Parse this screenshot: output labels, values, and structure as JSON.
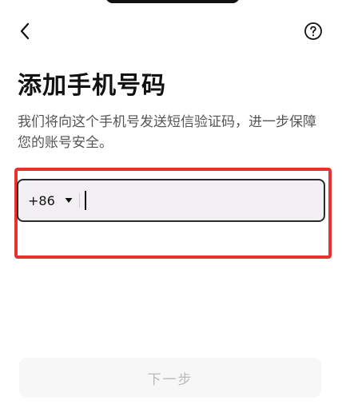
{
  "header": {
    "back_icon": "chevron-left-icon",
    "help_icon": "help-circle-icon"
  },
  "main": {
    "title": "添加手机号码",
    "description": "我们将向这个手机号发送短信验证码，进一步保障您的账号安全。",
    "phone": {
      "country_code": "+86",
      "dropdown_icon": "caret-down-icon",
      "value": "",
      "placeholder": ""
    },
    "next_button_label": "下一步"
  },
  "colors": {
    "highlight_border": "#e8322f",
    "input_background": "#f1eff1",
    "disabled_button_text": "#b9b9b9",
    "disabled_button_background": "#f7f7f7"
  }
}
